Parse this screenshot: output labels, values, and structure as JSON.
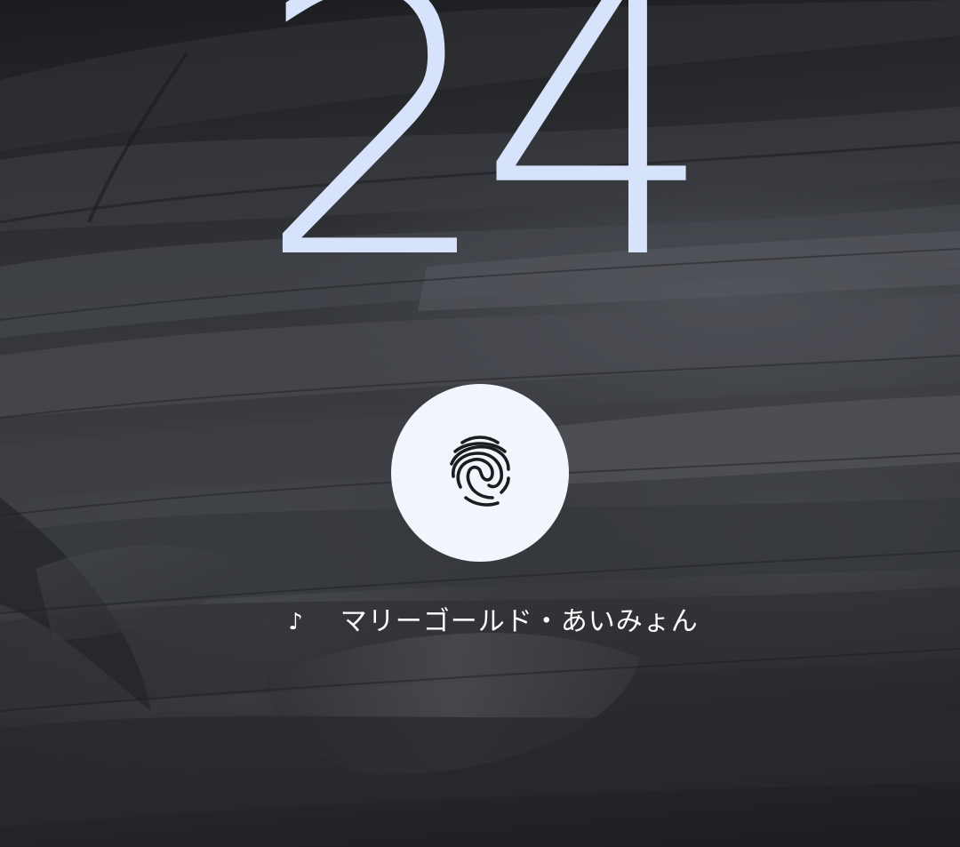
{
  "clock": {
    "minutes": "24",
    "color": "#d7e2fb"
  },
  "lock": {
    "fingerprint_icon": "fingerprint-icon",
    "button_color": "#f3f5fc"
  },
  "now_playing": {
    "icon": "music-note-icon",
    "icon_glyph": "♪",
    "text": "マリーゴールド・あいみょん"
  }
}
